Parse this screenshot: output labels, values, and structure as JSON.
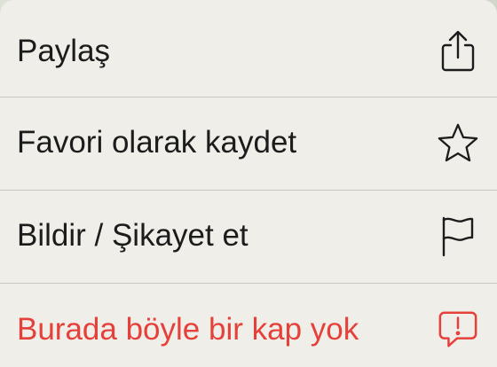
{
  "menu": {
    "items": [
      {
        "label": "Paylaş",
        "icon": "share-icon",
        "destructive": false
      },
      {
        "label": "Favori olarak kaydet",
        "icon": "star-icon",
        "destructive": false
      },
      {
        "label": "Bildir / Şikayet et",
        "icon": "flag-icon",
        "destructive": false
      },
      {
        "label": "Burada böyle bir kap yok",
        "icon": "report-bubble-icon",
        "destructive": true
      }
    ]
  },
  "colors": {
    "text": "#1c1c1c",
    "destructive": "#e5413a",
    "sheet_background": "#efeee9",
    "divider": "#c7c6c1"
  }
}
